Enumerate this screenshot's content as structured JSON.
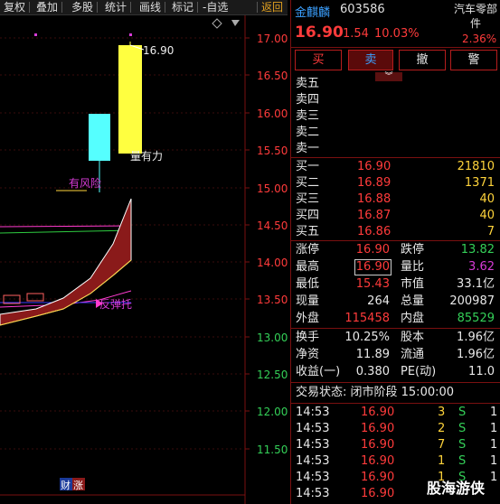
{
  "toolbar": {
    "items": [
      "复权",
      "叠加",
      "多股",
      "统计",
      "画线",
      "标记",
      "-自选",
      "返回"
    ]
  },
  "chart": {
    "price_axis": [
      "17.00",
      "16.50",
      "16.00",
      "15.50",
      "15.00",
      "14.50",
      "14.00",
      "13.50",
      "13.00",
      "12.50",
      "12.00",
      "11.50"
    ],
    "high_label": "16.90",
    "annotations": {
      "volume_power": "量有力",
      "risk": "有风险",
      "rebound": "反弹托",
      "finance": "财",
      "rise": "涨"
    }
  },
  "header": {
    "name": "金麒麟",
    "code": "603586",
    "sector": "汽车零部件",
    "sector_change": "2.36%",
    "price": "16.90",
    "change": "1.54",
    "change_pct": "10.03%"
  },
  "buttons": {
    "buy": "买",
    "sell": "卖",
    "cancel": "撤",
    "alert": "警"
  },
  "asks": [
    {
      "label": "卖五",
      "price": "",
      "vol": ""
    },
    {
      "label": "卖四",
      "price": "",
      "vol": ""
    },
    {
      "label": "卖三",
      "price": "",
      "vol": ""
    },
    {
      "label": "卖二",
      "price": "",
      "vol": ""
    },
    {
      "label": "卖一",
      "price": "",
      "vol": ""
    }
  ],
  "bids": [
    {
      "label": "买一",
      "price": "16.90",
      "vol": "21810"
    },
    {
      "label": "买二",
      "price": "16.89",
      "vol": "1371"
    },
    {
      "label": "买三",
      "price": "16.88",
      "vol": "40"
    },
    {
      "label": "买四",
      "price": "16.87",
      "vol": "40"
    },
    {
      "label": "买五",
      "price": "16.86",
      "vol": "7"
    }
  ],
  "stats": {
    "limit_up_label": "涨停",
    "limit_up": "16.90",
    "limit_down_label": "跌停",
    "limit_down": "13.82",
    "high_label": "最高",
    "high": "16.90",
    "vol_ratio_label": "量比",
    "vol_ratio": "3.62",
    "low_label": "最低",
    "low": "15.43",
    "mcap_label": "市值",
    "mcap": "33.1亿",
    "cur_vol_label": "现量",
    "cur_vol": "264",
    "total_vol_label": "总量",
    "total_vol": "200987",
    "outer_label": "外盘",
    "outer": "115458",
    "inner_label": "内盘",
    "inner": "85529",
    "turnover_label": "换手",
    "turnover": "10.25%",
    "equity_label": "股本",
    "equity": "1.96亿",
    "nav_label": "净资",
    "nav": "11.89",
    "float_label": "流通",
    "float": "1.96亿",
    "eps_label": "收益(一)",
    "eps": "0.380",
    "pe_label": "PE(动)",
    "pe": "11.0"
  },
  "status": {
    "text": "交易状态: 闭市阶段 15:00:00"
  },
  "ticks": [
    {
      "time": "14:53",
      "price": "16.90",
      "vol": "3",
      "dir": "S",
      "n": "1"
    },
    {
      "time": "14:53",
      "price": "16.90",
      "vol": "2",
      "dir": "S",
      "n": "1"
    },
    {
      "time": "14:53",
      "price": "16.90",
      "vol": "7",
      "dir": "S",
      "n": "1"
    },
    {
      "time": "14:53",
      "price": "16.90",
      "vol": "1",
      "dir": "S",
      "n": "1"
    },
    {
      "time": "14:53",
      "price": "16.90",
      "vol": "1",
      "dir": "S",
      "n": "1"
    },
    {
      "time": "14:53",
      "price": "16.90",
      "vol": "",
      "dir": "",
      "n": ""
    }
  ],
  "watermark": "股海游侠",
  "colors": {
    "up": "#ff3b3b",
    "down": "#34d058",
    "volume": "#ffd43b",
    "border": "#b51d1d"
  }
}
